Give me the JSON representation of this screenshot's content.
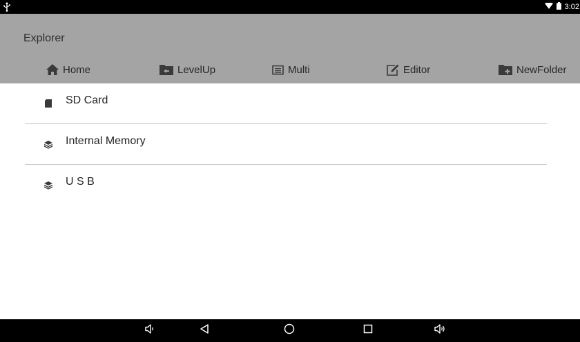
{
  "status_bar": {
    "time": "3:02",
    "icons": [
      "usb-icon",
      "wifi-icon",
      "battery-icon"
    ]
  },
  "header": {
    "title": "Explorer"
  },
  "toolbar": {
    "items": [
      {
        "label": "Home",
        "icon": "home-icon"
      },
      {
        "label": "LevelUp",
        "icon": "folder-up-icon"
      },
      {
        "label": "Multi",
        "icon": "multi-select-icon"
      },
      {
        "label": "Editor",
        "icon": "edit-icon"
      },
      {
        "label": "NewFolder",
        "icon": "new-folder-icon"
      }
    ]
  },
  "storage_list": [
    {
      "label": "SD Card",
      "icon": "sd-card-icon"
    },
    {
      "label": "Internal Memory",
      "icon": "storage-stack-icon"
    },
    {
      "label": "U S B",
      "icon": "storage-stack-icon"
    }
  ],
  "nav_bar": {
    "buttons": [
      "volume-down-icon",
      "back-icon",
      "home-circle-icon",
      "recents-icon",
      "volume-up-icon"
    ]
  },
  "colors": {
    "header_bg": "#a4a4a4",
    "text": "#262626",
    "divider": "#c9c9c9",
    "system_bars": "#000000"
  }
}
